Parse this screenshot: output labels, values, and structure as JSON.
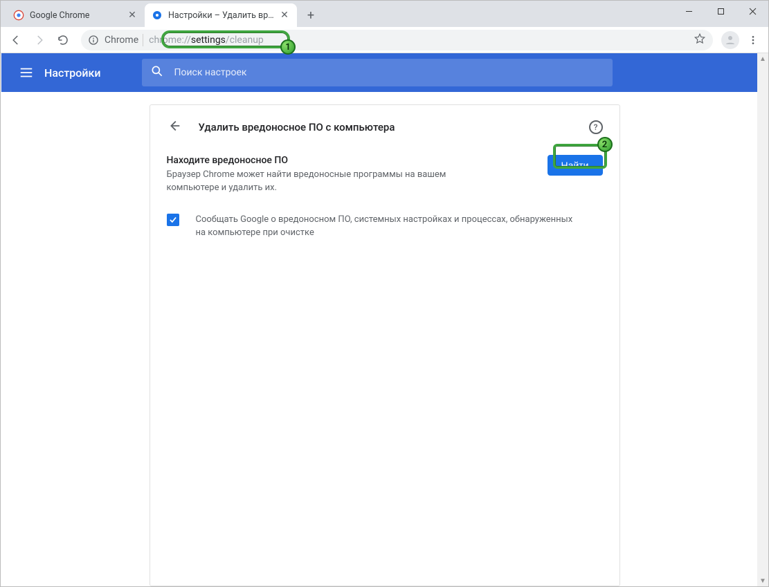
{
  "window": {
    "minimize": "–",
    "maximize": "□",
    "close": "✕"
  },
  "tabs": {
    "items": [
      {
        "title": "Google Chrome",
        "active": false
      },
      {
        "title": "Настройки – Удалить вредонос",
        "active": true
      }
    ]
  },
  "toolbar": {
    "host_label": "Chrome",
    "url_dim1": "chrome://",
    "url_strong": "settings",
    "url_dim2": "/cleanup"
  },
  "settings_header": {
    "title": "Настройки",
    "search_placeholder": "Поиск настроек"
  },
  "cleanup": {
    "page_title": "Удалить вредоносное ПО с компьютера",
    "section_title": "Находите вредоносное ПО",
    "section_desc": "Браузер Chrome может найти вредоносные программы на вашем компьютере и удалить их.",
    "find_button": "Найти",
    "checkbox_label": "Сообщать Google о вредоносном ПО, системных настройках и процессах, обнаруженных на компьютере при очистке"
  },
  "annotations": {
    "badge1": "1",
    "badge2": "2"
  }
}
